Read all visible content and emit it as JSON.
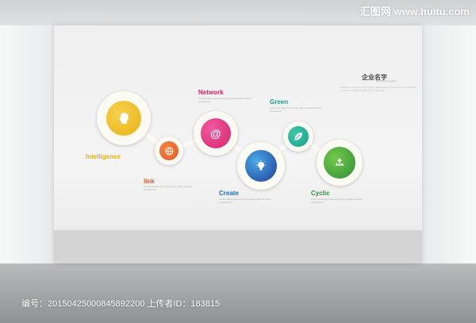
{
  "watermark": "汇图网 www.huitu.com",
  "wall": {
    "logo": "企业名字",
    "logo_sub": "Dolphins Company",
    "logo_desc": "enterprise culture text description placeholder lorem ipsum dolor sit amet consectetur adipiscing elit sed do eiusmod"
  },
  "nodes": {
    "intelligence": {
      "label": "Intelligence",
      "color": "#e8b21a"
    },
    "link": {
      "label": "link",
      "color": "#e35a2a"
    },
    "network": {
      "label": "Network",
      "color": "#d8246c"
    },
    "create": {
      "label": "Create",
      "color": "#1f6fc0"
    },
    "green": {
      "label": "Green",
      "color": "#16a38a"
    },
    "cyclic": {
      "label": "Cyclic",
      "color": "#3aa33a"
    }
  },
  "descriptions": {
    "network": "network description text lorem ipsum dolor sit amet consectetur",
    "green": "green description text lorem ipsum dolor sit amet consectetur",
    "link": "link description text lorem ipsum dolor sit amet consectetur",
    "create": "create description text lorem ipsum dolor sit amet consectetur",
    "cyclic": "cyclic description text lorem ipsum dolor sit amet consectetur"
  },
  "footer": {
    "text": "编号：20150425000845892200 上传者ID：183815"
  }
}
